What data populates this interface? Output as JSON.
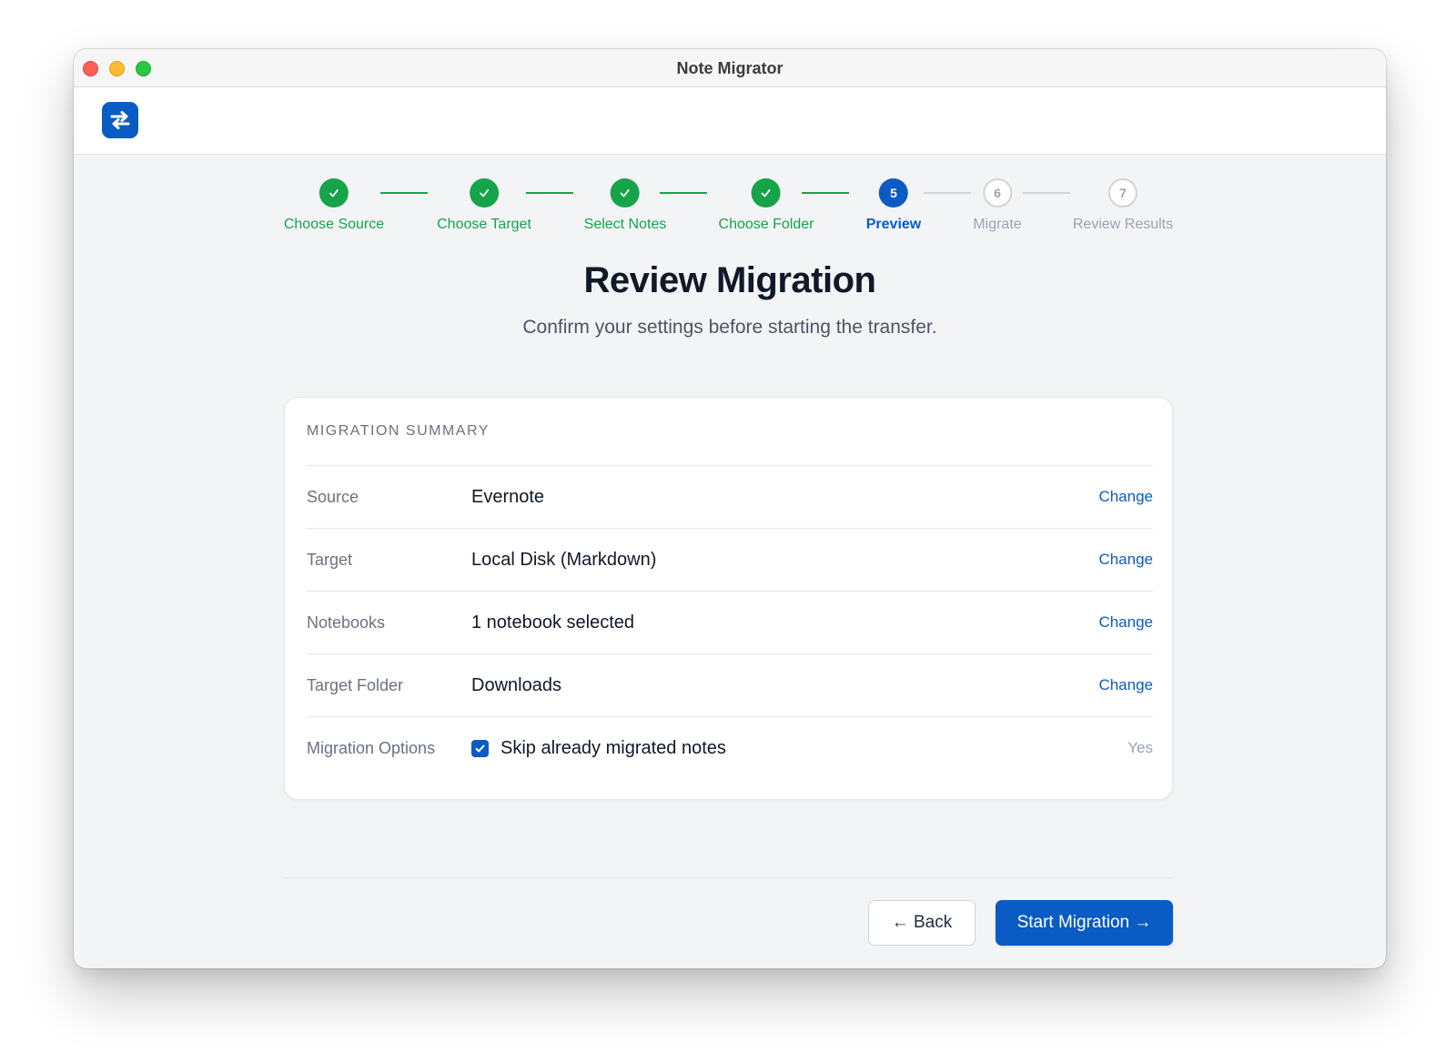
{
  "window": {
    "title": "Note Migrator"
  },
  "appbar": {
    "logo_icon": "swap-arrows-icon",
    "menu_icon": "hamburger-menu-icon"
  },
  "steps": [
    {
      "number": "1",
      "label": "Choose Source",
      "status": "done"
    },
    {
      "number": "2",
      "label": "Choose Target",
      "status": "done"
    },
    {
      "number": "3",
      "label": "Select Notes",
      "status": "done"
    },
    {
      "number": "4",
      "label": "Choose Folder",
      "status": "done"
    },
    {
      "number": "5",
      "label": "Preview",
      "status": "active"
    },
    {
      "number": "6",
      "label": "Migrate",
      "status": "pending"
    },
    {
      "number": "7",
      "label": "Review Results",
      "status": "pending"
    }
  ],
  "page": {
    "title": "Review Migration",
    "subtitle": "Confirm your settings before starting the transfer."
  },
  "summary": {
    "title": "MIGRATION SUMMARY",
    "rows": [
      {
        "label": "Source",
        "value": "Evernote",
        "action": "Change"
      },
      {
        "label": "Target",
        "value": "Local Disk (Markdown)",
        "action": "Change"
      },
      {
        "label": "Notebooks",
        "value": "1 notebook selected",
        "action": "Change"
      },
      {
        "label": "Target Folder",
        "value": "Downloads",
        "action": "Change"
      }
    ],
    "options": {
      "label": "Migration Options",
      "checkbox_label": "Skip already migrated notes",
      "checked": true,
      "status": "Yes"
    }
  },
  "footer": {
    "back_label": "← Back",
    "start_label": "Start Migration →"
  },
  "colors": {
    "accent": "#0a5bc4",
    "success": "#16a34a",
    "pending": "#d1d5db"
  }
}
